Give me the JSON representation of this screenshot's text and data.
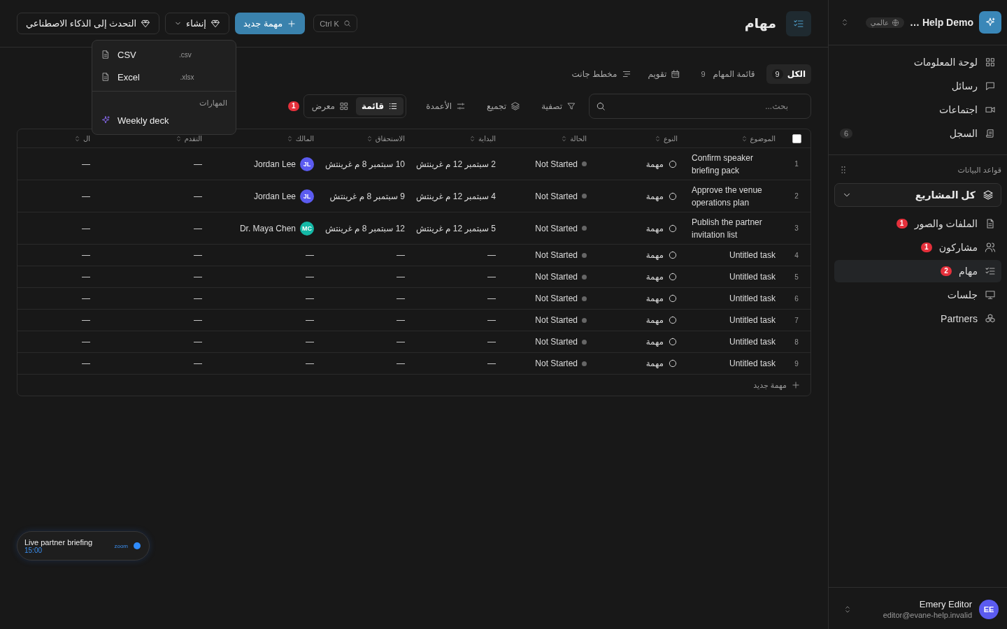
{
  "sidebar": {
    "workspace": "Help Demo …",
    "scope_badge": "عالمي",
    "nav": [
      {
        "label": "لوحة المعلومات",
        "selected": false
      },
      {
        "label": "رسائل",
        "selected": false
      },
      {
        "label": "اجتماعات",
        "selected": false
      },
      {
        "label": "السجل",
        "selected": false,
        "count": "6"
      }
    ],
    "section_title": "قواعد البيانات",
    "project_select": "كل المشاريع",
    "databases": [
      {
        "label": "الملفات والصور",
        "selected": false,
        "badge": "1"
      },
      {
        "label": "مشاركون",
        "selected": false,
        "badge": "1"
      },
      {
        "label": "مهام",
        "selected": true,
        "badge": "2"
      },
      {
        "label": "جلسات",
        "selected": false
      },
      {
        "label": "Partners",
        "selected": false
      }
    ],
    "user": {
      "initials": "EE",
      "name": "Emery Editor",
      "email": "editor@evane-help.invalid",
      "color": "#5b5bf0"
    }
  },
  "header": {
    "title": "مهام",
    "search_shortcut": "Ctrl K",
    "new_button": "مهمة جديد",
    "create_button": "إنشاء",
    "ai_button": "التحدث إلى الذكاء الاصطناعي"
  },
  "tabs": [
    {
      "label": "الكل",
      "count": "9",
      "selected": true
    },
    {
      "label": "قائمة المهام",
      "count": "9",
      "selected": false
    },
    {
      "label": "تقويم",
      "selected": false
    },
    {
      "label": "مخطط جانت",
      "selected": false
    }
  ],
  "toolbar": {
    "search_placeholder": "بحث...",
    "filter": "تصفية",
    "group": "تجميع",
    "columns": "الأعمدة",
    "views": [
      {
        "label": "قائمة",
        "selected": true
      },
      {
        "label": "معرض",
        "selected": false
      }
    ],
    "alert_badge": "1"
  },
  "create_menu": {
    "items": [
      {
        "label": "CSV",
        "extension": ".csv"
      },
      {
        "label": "Excel",
        "extension": ".xlsx"
      }
    ],
    "section": "المهارات",
    "skills": [
      "Weekly deck"
    ]
  },
  "table": {
    "select_all": {
      "checked": false
    },
    "columns": [
      "الموضوع",
      "النوع",
      "الحالة",
      "البداية",
      "الاستحقاق",
      "المالك",
      "التقدم",
      "ال"
    ],
    "rows": [
      {
        "number": "1",
        "subject": "Confirm speaker briefing pack",
        "type": "مهمة",
        "status": "Not Started",
        "start": "2 سبتمبر 12 م غرينتش",
        "due": "10 سبتمبر 8 م غرينتش",
        "owner": {
          "initials": "JL",
          "name": "Jordan Lee",
          "color": "#5b5bf0"
        },
        "progress": "—",
        "column_9": "—"
      },
      {
        "number": "2",
        "subject": "Approve the venue operations plan",
        "type": "مهمة",
        "status": "Not Started",
        "start": "4 سبتمبر 12 م غرينتش",
        "due": "9 سبتمبر 8 م غرينتش",
        "owner": {
          "initials": "JL",
          "name": "Jordan Lee",
          "color": "#5b5bf0"
        },
        "progress": "—",
        "column_9": "—"
      },
      {
        "number": "3",
        "subject": "Publish the partner invitation list",
        "type": "مهمة",
        "status": "Not Started",
        "start": "5 سبتمبر 12 م غرينتش",
        "due": "12 سبتمبر 8 م غرينتش",
        "owner": {
          "initials": "MC",
          "name": "Dr. Maya Chen",
          "color": "#14b8a6"
        },
        "progress": "—",
        "column_9": "—"
      },
      {
        "number": "4",
        "subject": "Untitled task",
        "type": "مهمة",
        "status": "Not Started",
        "start": "—",
        "due": "—",
        "owner_empty": "—",
        "progress": "—",
        "column_9": "—"
      },
      {
        "number": "5",
        "subject": "Untitled task",
        "type": "مهمة",
        "status": "Not Started",
        "start": "—",
        "due": "—",
        "owner_empty": "—",
        "progress": "—",
        "column_9": "—"
      },
      {
        "number": "6",
        "subject": "Untitled task",
        "type": "مهمة",
        "status": "Not Started",
        "start": "—",
        "due": "—",
        "owner_empty": "—",
        "progress": "—",
        "column_9": "—"
      },
      {
        "number": "7",
        "subject": "Untitled task",
        "type": "مهمة",
        "status": "Not Started",
        "start": "—",
        "due": "—",
        "owner_empty": "—",
        "progress": "—",
        "column_9": "—"
      },
      {
        "number": "8",
        "subject": "Untitled task",
        "type": "مهمة",
        "status": "Not Started",
        "start": "—",
        "due": "—",
        "owner_empty": "—",
        "progress": "—",
        "column_9": "—"
      },
      {
        "number": "9",
        "subject": "Untitled task",
        "type": "مهمة",
        "status": "Not Started",
        "start": "—",
        "due": "—",
        "owner_empty": "—",
        "progress": "—",
        "column_9": "—"
      }
    ],
    "add_row": "مهمة جديد"
  },
  "meeting_pill": {
    "title": "Live partner briefing",
    "time": "15:00",
    "provider": "zoom"
  }
}
